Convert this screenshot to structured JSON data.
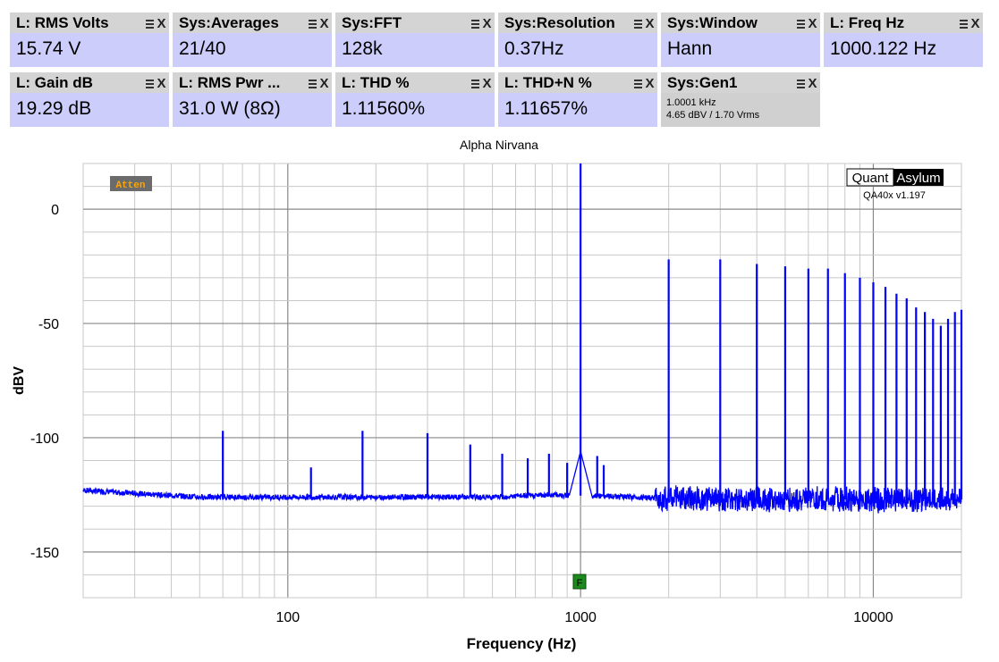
{
  "tiles": [
    {
      "title": "L: RMS Volts",
      "value": "15.74 V"
    },
    {
      "title": "Sys:Averages",
      "value": "21/40"
    },
    {
      "title": "Sys:FFT",
      "value": "128k"
    },
    {
      "title": "Sys:Resolution",
      "value": "0.37Hz"
    },
    {
      "title": "Sys:Window",
      "value": "Hann"
    },
    {
      "title": "L: Freq Hz",
      "value": "1000.122 Hz"
    },
    {
      "title": "L: Gain dB",
      "value": "19.29 dB"
    },
    {
      "title": "L: RMS Pwr ...",
      "value": "31.0 W (8Ω)"
    },
    {
      "title": "L: THD %",
      "value": "1.11560%"
    },
    {
      "title": "L: THD+N %",
      "value": "1.11657%"
    },
    {
      "title": "Sys:Gen1",
      "line1": "1.0001 kHz",
      "line2": "4.65 dBV  / 1.70 Vrms"
    }
  ],
  "tile_controls": {
    "menu_icon": "hamburger-menu-icon",
    "close_glyph": "X"
  },
  "chart_data": {
    "type": "line",
    "title": "Alpha Nirvana",
    "xlabel": "Frequency (Hz)",
    "ylabel": "dBV",
    "x_scale": "log",
    "xlim": [
      20,
      20000
    ],
    "ylim": [
      -170,
      20
    ],
    "x_ticks": [
      "100",
      "1000",
      "10000"
    ],
    "y_ticks": [
      "0",
      "-50",
      "-100",
      "-150"
    ],
    "grid": true,
    "line_color": "#0000ff",
    "noise_floor": [
      {
        "x": 20,
        "y": -123
      },
      {
        "x": 50,
        "y": -126
      },
      {
        "x": 100,
        "y": -126
      },
      {
        "x": 200,
        "y": -126
      },
      {
        "x": 500,
        "y": -126
      },
      {
        "x": 800,
        "y": -125
      },
      {
        "x": 1500,
        "y": -126
      },
      {
        "x": 3000,
        "y": -127
      },
      {
        "x": 10000,
        "y": -127
      },
      {
        "x": 20000,
        "y": -127
      }
    ],
    "peaks": [
      {
        "x": 60,
        "y": -97
      },
      {
        "x": 120,
        "y": -113
      },
      {
        "x": 180,
        "y": -97
      },
      {
        "x": 300,
        "y": -98
      },
      {
        "x": 420,
        "y": -103
      },
      {
        "x": 540,
        "y": -107
      },
      {
        "x": 660,
        "y": -109
      },
      {
        "x": 780,
        "y": -107
      },
      {
        "x": 900,
        "y": -111
      },
      {
        "x": 1000,
        "y": 20
      },
      {
        "x": 1140,
        "y": -108
      },
      {
        "x": 1200,
        "y": -112
      },
      {
        "x": 2000,
        "y": -22
      },
      {
        "x": 3000,
        "y": -22
      },
      {
        "x": 4000,
        "y": -24
      },
      {
        "x": 5000,
        "y": -25
      },
      {
        "x": 6000,
        "y": -26
      },
      {
        "x": 7000,
        "y": -26
      },
      {
        "x": 8000,
        "y": -28
      },
      {
        "x": 9000,
        "y": -30
      },
      {
        "x": 10000,
        "y": -32
      },
      {
        "x": 11000,
        "y": -34
      },
      {
        "x": 12000,
        "y": -37
      },
      {
        "x": 13000,
        "y": -39
      },
      {
        "x": 14000,
        "y": -43
      },
      {
        "x": 15000,
        "y": -45
      },
      {
        "x": 16000,
        "y": -48
      },
      {
        "x": 17000,
        "y": -51
      },
      {
        "x": 18000,
        "y": -48
      },
      {
        "x": 19000,
        "y": -45
      },
      {
        "x": 20000,
        "y": -44
      }
    ],
    "markers": {
      "atten_label": "Atten",
      "f_marker": "F"
    },
    "brand": {
      "left": "Quant",
      "right": "Asylum",
      "version": "QA40x v1.197"
    }
  }
}
